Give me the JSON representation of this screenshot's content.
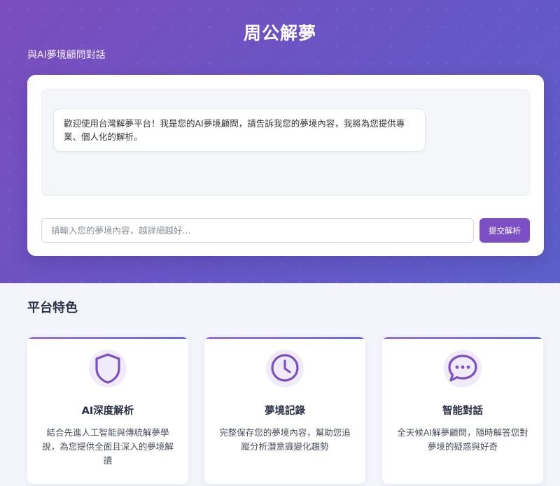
{
  "header": {
    "title": "周公解夢",
    "subtitle": "與AI夢境顧問對話"
  },
  "chat": {
    "bot_message": "歡迎使用台灣解夢平台！我是您的AI夢境顧問，請告訴我您的夢境內容，我將為您提供專業、個人化的解析。",
    "input_placeholder": "請輸入您的夢境內容，越詳細越好...",
    "input_value": "",
    "submit_label": "提交解析"
  },
  "features": {
    "title": "平台特色",
    "items": [
      {
        "icon": "shield-icon",
        "name": "AI深度解析",
        "description": "結合先進人工智能與傳統解夢學說，為您提供全面且深入的夢境解讀"
      },
      {
        "icon": "clock-icon",
        "name": "夢境記錄",
        "description": "完整保存您的夢境內容，幫助您追蹤分析潛意識變化趨勢"
      },
      {
        "icon": "chat-bubble-icon",
        "name": "智能對話",
        "description": "全天候AI解夢顧問，隨時解答您對夢境的疑惑與好奇"
      }
    ]
  },
  "colors": {
    "accent": "#7d4fc4",
    "hero_start": "#7c4dbd",
    "hero_end": "#5c5fc9",
    "icon_stroke": "#7e4fc2",
    "icon_bg": "#efebf8"
  }
}
